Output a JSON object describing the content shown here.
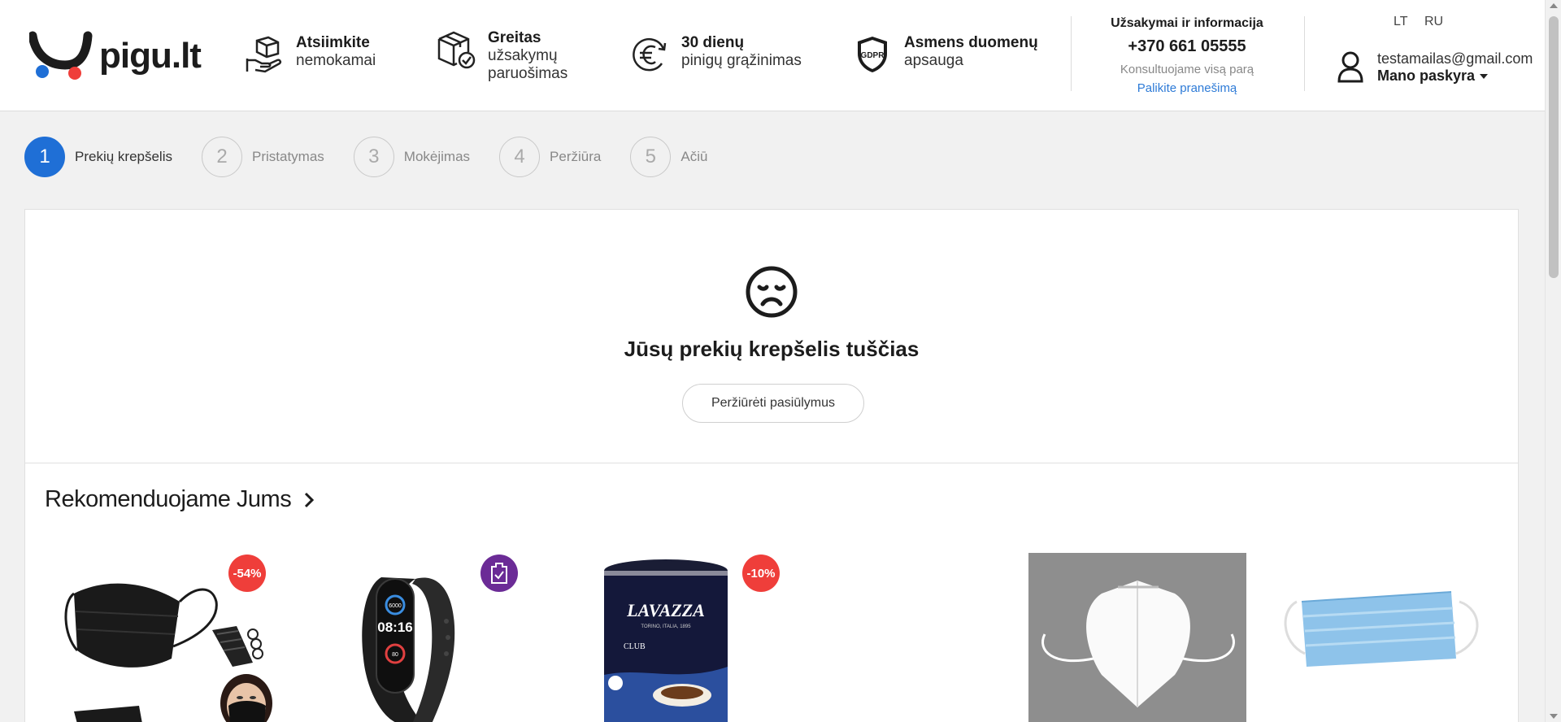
{
  "header": {
    "logo_text": "pigu.lt",
    "features": [
      {
        "bold": "Atsiimkite",
        "text": "nemokamai",
        "icon": "hand-box-icon"
      },
      {
        "bold": "Greitas",
        "text": "užsakymų paruošimas",
        "icon": "box-check-icon"
      },
      {
        "bold": "30 dienų",
        "text": "pinigų grąžinimas",
        "icon": "euro-return-icon"
      },
      {
        "bold": "Asmens duomenų",
        "text": "apsauga",
        "icon": "gdpr-shield-icon"
      }
    ],
    "gdpr_label": "GDPR",
    "contact": {
      "title": "Užsakymai ir informacija",
      "phone": "+370 661 05555",
      "sub": "Konsultuojame visą parą",
      "link": "Palikite pranešimą"
    },
    "languages": [
      "LT",
      "RU"
    ],
    "account": {
      "email": "testamailas@gmail.com",
      "label": "Mano paskyra"
    }
  },
  "steps": [
    {
      "num": "1",
      "label": "Prekių krepšelis",
      "active": true
    },
    {
      "num": "2",
      "label": "Pristatymas",
      "active": false
    },
    {
      "num": "3",
      "label": "Mokėjimas",
      "active": false
    },
    {
      "num": "4",
      "label": "Peržiūra",
      "active": false
    },
    {
      "num": "5",
      "label": "Ačiū",
      "active": false
    }
  ],
  "cart": {
    "empty_title": "Jūsų prekių krepšelis tuščias",
    "button": "Peržiūrėti pasiūlymus"
  },
  "recommendations": {
    "title": "Rekomenduojame Jums",
    "products": [
      {
        "name": "black-face-masks",
        "badge": "-54%"
      },
      {
        "name": "fitness-band",
        "badge": ""
      },
      {
        "name": "lavazza-coffee-can",
        "badge": "-10%"
      },
      {
        "name": "ffp2-respirator",
        "badge": ""
      },
      {
        "name": "blue-surgical-mask",
        "badge": ""
      }
    ],
    "watch_time": "08:16",
    "watch_steps": "6000",
    "watch_hr": "80",
    "lavazza_brand": "LAVAZZA",
    "lavazza_origin": "TORINO, ITALIA, 1895",
    "lavazza_line": "CLUB"
  },
  "colors": {
    "accent": "#1f6fd6",
    "link": "#2e7bd7",
    "badge_red": "#ef3e3a",
    "badge_purple": "#6b2b96",
    "logo_red": "#ef3e3a",
    "logo_blue": "#1f6fd6"
  }
}
